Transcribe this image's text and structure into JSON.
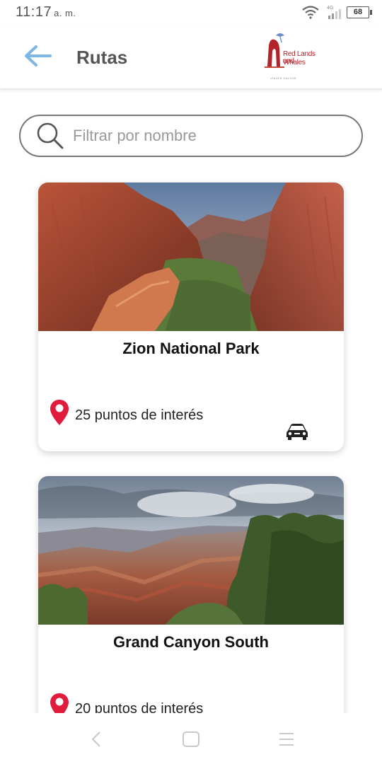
{
  "status_bar": {
    "time": "11:17",
    "ampm": "a. m.",
    "network_label": "4G",
    "battery": "68"
  },
  "app_bar": {
    "title": "Rutas",
    "logo": {
      "line1": "Red Lands and",
      "line2": "Whales",
      "subtitle": "VIAJES SALTOR"
    }
  },
  "search": {
    "placeholder": "Filtrar por nombre",
    "value": ""
  },
  "routes": [
    {
      "name": "Zion National Park",
      "points_of_interest": "25 puntos de interés",
      "transport_icon": "car-icon"
    },
    {
      "name": "Grand Canyon South",
      "points_of_interest": "20 puntos de interés",
      "transport_icon": "car-icon"
    }
  ],
  "colors": {
    "accent_back_arrow": "#7cb7e6",
    "pin_red": "#e01b3c",
    "title_gray": "#555555"
  },
  "icons": {
    "back": "arrow-left-icon",
    "search": "magnifier-icon",
    "pin": "map-pin-icon",
    "car": "car-icon",
    "nav_back": "chevron-left-icon",
    "nav_home": "square-icon",
    "nav_menu": "menu-icon"
  }
}
